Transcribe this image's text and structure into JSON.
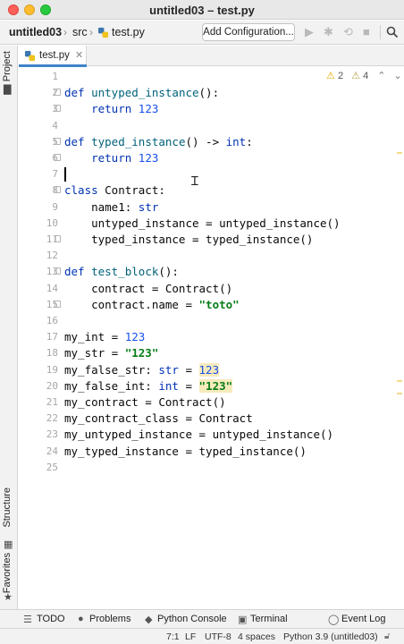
{
  "window": {
    "title": "untitled03 – test.py"
  },
  "nav": {
    "project": "untitled03",
    "folder": "src",
    "file": "test.py",
    "config_button": "Add Configuration..."
  },
  "tools_left": {
    "project": "Project",
    "structure": "Structure",
    "favorites": "Favorites"
  },
  "tab": {
    "label": "test.py"
  },
  "inspections": {
    "warnings": "2",
    "weak_warnings": "4"
  },
  "editor": {
    "lines": [
      {
        "n": "1"
      },
      {
        "n": "2",
        "tokens": [
          [
            "kw",
            "def "
          ],
          [
            "fn",
            "untyped_instance"
          ],
          [
            "",
            "():"
          ]
        ],
        "fold": true
      },
      {
        "n": "3",
        "tokens": [
          [
            "",
            "    "
          ],
          [
            "kw",
            "return "
          ],
          [
            "num",
            "123"
          ]
        ],
        "fold": true
      },
      {
        "n": "4"
      },
      {
        "n": "5",
        "tokens": [
          [
            "kw",
            "def "
          ],
          [
            "fn",
            "typed_instance"
          ],
          [
            "",
            "() -> "
          ],
          [
            "kw",
            "int"
          ],
          [
            "",
            ":"
          ]
        ],
        "fold": true
      },
      {
        "n": "6",
        "tokens": [
          [
            "",
            "    "
          ],
          [
            "kw",
            "return "
          ],
          [
            "num",
            "123"
          ]
        ],
        "fold": true
      },
      {
        "n": "7",
        "caret": true
      },
      {
        "n": "8",
        "tokens": [
          [
            "kw",
            "class "
          ],
          [
            "",
            "Contract:"
          ]
        ],
        "fold": true
      },
      {
        "n": "9",
        "tokens": [
          [
            "",
            "    name1: "
          ],
          [
            "kw",
            "str"
          ]
        ]
      },
      {
        "n": "10",
        "tokens": [
          [
            "",
            "    untyped_instance = untyped_instance()"
          ]
        ]
      },
      {
        "n": "11",
        "tokens": [
          [
            "",
            "    typed_instance = typed_instance()"
          ]
        ],
        "fold": true
      },
      {
        "n": "12"
      },
      {
        "n": "13",
        "tokens": [
          [
            "kw",
            "def "
          ],
          [
            "fn",
            "test_block"
          ],
          [
            "",
            "():"
          ]
        ],
        "fold": true
      },
      {
        "n": "14",
        "tokens": [
          [
            "",
            "    contract = Contract()"
          ]
        ]
      },
      {
        "n": "15",
        "tokens": [
          [
            "",
            "    contract.name = "
          ],
          [
            "str",
            "\"toto\""
          ]
        ],
        "fold": true
      },
      {
        "n": "16"
      },
      {
        "n": "17",
        "tokens": [
          [
            "",
            "my_int = "
          ],
          [
            "num",
            "123"
          ]
        ]
      },
      {
        "n": "18",
        "tokens": [
          [
            "",
            "my_str = "
          ],
          [
            "str",
            "\"123\""
          ]
        ]
      },
      {
        "n": "19",
        "tokens": [
          [
            "",
            "my_false_str: "
          ],
          [
            "kw",
            "str"
          ],
          [
            "",
            " = "
          ],
          [
            "num warn-hl",
            "123"
          ]
        ]
      },
      {
        "n": "20",
        "tokens": [
          [
            "",
            "my_false_int: "
          ],
          [
            "kw",
            "int"
          ],
          [
            "",
            " = "
          ],
          [
            "str warn-hl",
            "\"123\""
          ]
        ]
      },
      {
        "n": "21",
        "tokens": [
          [
            "",
            "my_contract = Contract()"
          ]
        ]
      },
      {
        "n": "22",
        "tokens": [
          [
            "",
            "my_contract_class = Contract"
          ]
        ]
      },
      {
        "n": "23",
        "tokens": [
          [
            "",
            "my_untyped_instance = untyped_instance()"
          ]
        ]
      },
      {
        "n": "24",
        "tokens": [
          [
            "",
            "my_typed_instance = typed_instance()"
          ]
        ]
      },
      {
        "n": "25"
      }
    ]
  },
  "bottom_tools": {
    "todo": "TODO",
    "problems": "Problems",
    "python_console": "Python Console",
    "terminal": "Terminal",
    "event_log": "Event Log"
  },
  "status": {
    "position": "7:1",
    "line_sep": "LF",
    "encoding": "UTF-8",
    "indent": "4 spaces",
    "interpreter": "Python 3.9 (untitled03)"
  }
}
